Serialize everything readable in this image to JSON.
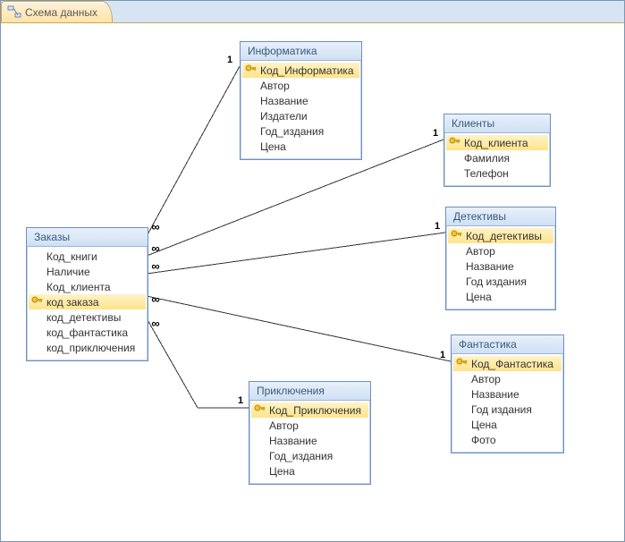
{
  "tab": {
    "title": "Схема данных"
  },
  "tables": {
    "orders": {
      "title": "Заказы",
      "fields": [
        {
          "name": "Код_книги",
          "key": false
        },
        {
          "name": "Наличие",
          "key": false
        },
        {
          "name": "Код_клиента",
          "key": false
        },
        {
          "name": "код заказа",
          "key": true
        },
        {
          "name": "код_детективы",
          "key": false
        },
        {
          "name": "код_фантастика",
          "key": false
        },
        {
          "name": "код_приключения",
          "key": false
        }
      ]
    },
    "inform": {
      "title": "Информатика",
      "fields": [
        {
          "name": "Код_Информатика",
          "key": true
        },
        {
          "name": "Автор",
          "key": false
        },
        {
          "name": "Название",
          "key": false
        },
        {
          "name": "Издатели",
          "key": false
        },
        {
          "name": "Год_издания",
          "key": false
        },
        {
          "name": "Цена",
          "key": false
        }
      ]
    },
    "clients": {
      "title": "Клиенты",
      "fields": [
        {
          "name": "Код_клиента",
          "key": true
        },
        {
          "name": "Фамилия",
          "key": false
        },
        {
          "name": "Телефон",
          "key": false
        }
      ]
    },
    "detect": {
      "title": "Детективы",
      "fields": [
        {
          "name": "Код_детективы",
          "key": true
        },
        {
          "name": "Автор",
          "key": false
        },
        {
          "name": "Название",
          "key": false
        },
        {
          "name": "Год издания",
          "key": false
        },
        {
          "name": "Цена",
          "key": false
        }
      ]
    },
    "fant": {
      "title": "Фантастика",
      "fields": [
        {
          "name": "Код_Фантастика",
          "key": true
        },
        {
          "name": "Автор",
          "key": false
        },
        {
          "name": "Название",
          "key": false
        },
        {
          "name": "Год издания",
          "key": false
        },
        {
          "name": "Цена",
          "key": false
        },
        {
          "name": "Фото",
          "key": false
        }
      ]
    },
    "adv": {
      "title": "Приключения",
      "fields": [
        {
          "name": "Код_Приключения",
          "key": true
        },
        {
          "name": "Автор",
          "key": false
        },
        {
          "name": "Название",
          "key": false
        },
        {
          "name": "Год_издания",
          "key": false
        },
        {
          "name": "Цена",
          "key": false
        }
      ]
    }
  },
  "relationships": [
    {
      "from": "orders",
      "to": "inform",
      "many_symbol": "∞",
      "one_symbol": "1"
    },
    {
      "from": "orders",
      "to": "clients",
      "many_symbol": "∞",
      "one_symbol": "1"
    },
    {
      "from": "orders",
      "to": "detect",
      "many_symbol": "∞",
      "one_symbol": "1"
    },
    {
      "from": "orders",
      "to": "fant",
      "many_symbol": "∞",
      "one_symbol": "1"
    },
    {
      "from": "orders",
      "to": "adv",
      "many_symbol": "∞",
      "one_symbol": "1"
    }
  ]
}
